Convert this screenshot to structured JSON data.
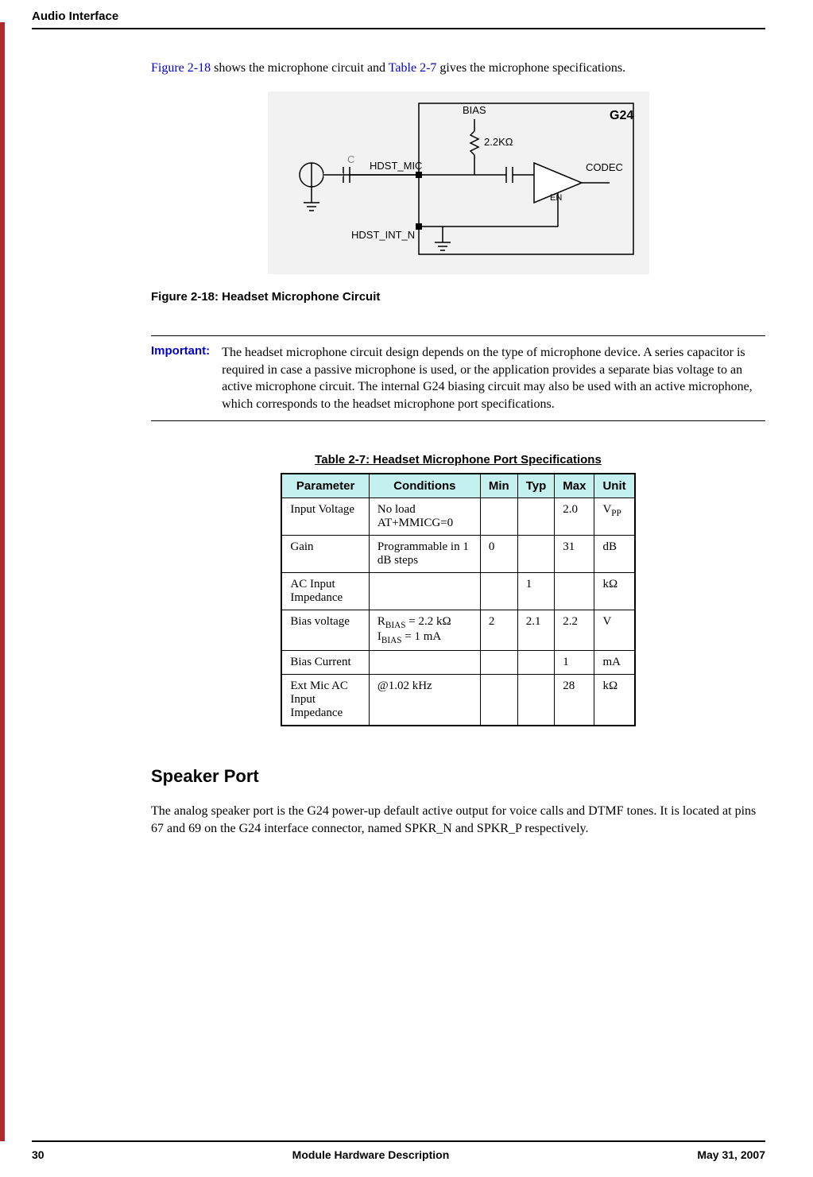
{
  "header": {
    "section_title": "Audio Interface"
  },
  "intro": {
    "pre": "",
    "link1": "Figure 2-18",
    "mid1": " shows the microphone circuit and ",
    "link2": "Table 2-7",
    "mid2": " gives the microphone specifications."
  },
  "figure": {
    "labels": {
      "bias": "BIAS",
      "g24": "G24",
      "res": "2.2KΩ",
      "hdst_mic": "HDST_MIC",
      "codec": "CODEC",
      "en": "EN",
      "c": "C",
      "hdst_int_n": "HDST_INT_N"
    },
    "caption": "Figure 2-18: Headset Microphone Circuit"
  },
  "note": {
    "label": "Important:",
    "text": "The headset microphone circuit design depends on the type of microphone device. A series capacitor is required in case a passive microphone is used, or the application provides a separate bias voltage to an active microphone circuit. The internal G24 biasing circuit may also be used with an active microphone, which corresponds to the headset microphone port specifications."
  },
  "table": {
    "caption": "Table 2-7: Headset Microphone Port Specifications",
    "headers": [
      "Parameter",
      "Conditions",
      "Min",
      "Typ",
      "Max",
      "Unit"
    ],
    "rows": [
      {
        "param": "Input Voltage",
        "cond": "No load\nAT+MMICG=0",
        "min": "",
        "typ": "",
        "max": "2.0",
        "unit_html": "V<sub>PP</sub>"
      },
      {
        "param": "Gain",
        "cond": "Programmable in 1 dB steps",
        "min": "0",
        "typ": "",
        "max": "31",
        "unit_html": "dB"
      },
      {
        "param": "AC Input Impedance",
        "cond": "",
        "min": "",
        "typ": "1",
        "max": "",
        "unit_html": "kΩ"
      },
      {
        "param": "Bias voltage",
        "cond_html": "R<sub>BIAS</sub> = 2.2 kΩ<br>I<sub>BIAS</sub> = 1 mA",
        "min": "2",
        "typ": "2.1",
        "max": "2.2",
        "unit_html": "V"
      },
      {
        "param": "Bias Current",
        "cond": "",
        "min": "",
        "typ": "",
        "max": "1",
        "unit_html": "mA"
      },
      {
        "param": "Ext Mic AC Input Impedance",
        "cond": "@1.02 kHz",
        "min": "",
        "typ": "",
        "max": "28",
        "unit_html": "kΩ"
      }
    ]
  },
  "section2": {
    "heading": "Speaker Port",
    "para": "The analog speaker port is the G24 power-up default active output for voice calls and DTMF tones. It is located at pins 67 and 69 on the G24 interface connector, named SPKR_N and SPKR_P respectively."
  },
  "footer": {
    "page": "30",
    "title": "Module Hardware Description",
    "date": "May 31, 2007"
  }
}
